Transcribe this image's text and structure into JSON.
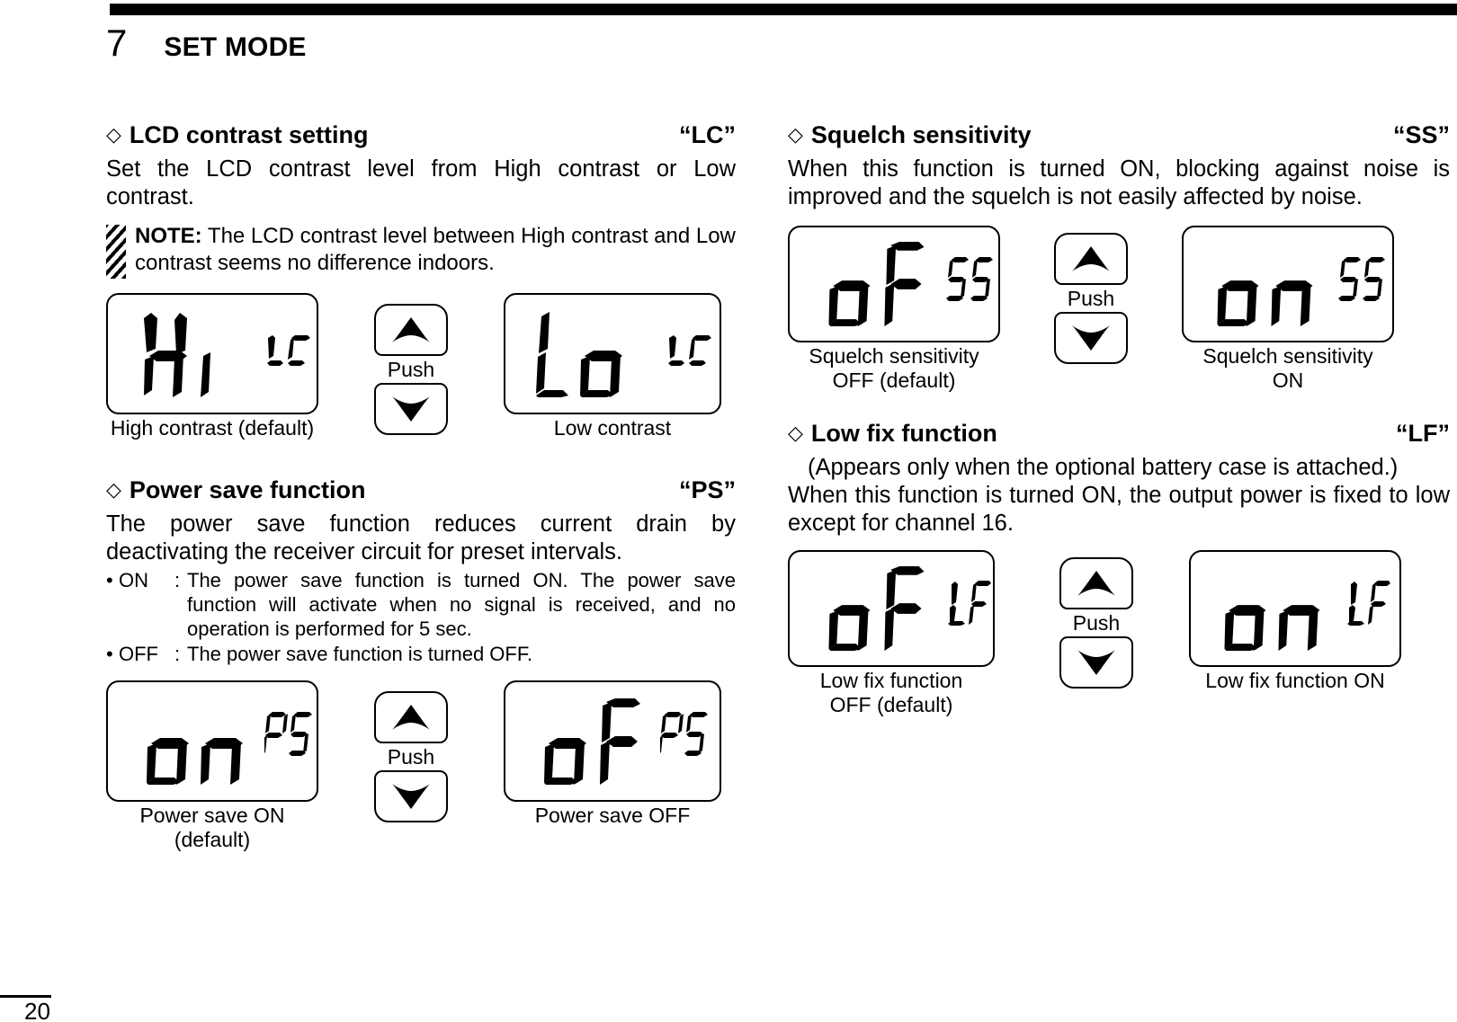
{
  "header": {
    "chapter_number": "7",
    "chapter_title": "SET MODE"
  },
  "footer": {
    "page_number": "20"
  },
  "left_column": {
    "sections": [
      {
        "diamond": "◇",
        "title": "LCD contrast setting",
        "code": "“LC”",
        "body": "Set the LCD contrast level from High contrast or Low contrast.",
        "note": {
          "label": "NOTE:",
          "text": " The LCD contrast level between High contrast and Low contrast seems no difference indoors."
        },
        "diagram": {
          "left_display": {
            "value": "Hi",
            "code": "LC"
          },
          "left_caption": "High contrast (default)",
          "push_label": "Push",
          "right_display": {
            "value": "Lo",
            "code": "LC"
          },
          "right_caption": "Low contrast"
        }
      },
      {
        "diamond": "◇",
        "title": "Power save function",
        "code": "“PS”",
        "body": "The power save function reduces current drain by deactivating the receiver circuit for preset intervals.",
        "bullets": [
          {
            "dot": "•",
            "key": "ON",
            "colon": ":",
            "text": "The power save function is turned ON. The power save function will activate when no signal is received, and no operation is performed for 5 sec."
          },
          {
            "dot": "•",
            "key": "OFF",
            "colon": ":",
            "text": "The power save function is turned OFF."
          }
        ],
        "diagram": {
          "left_display": {
            "value": "on",
            "code": "PS"
          },
          "left_caption": "Power save ON\n(default)",
          "push_label": "Push",
          "right_display": {
            "value": "oF",
            "code": "PS"
          },
          "right_caption": "Power save OFF"
        }
      }
    ]
  },
  "right_column": {
    "sections": [
      {
        "diamond": "◇",
        "title": "Squelch sensitivity",
        "code": "“SS”",
        "body": "When this function is turned ON, blocking against noise is improved and the squelch is not easily affected by noise.",
        "diagram": {
          "left_display": {
            "value": "oF",
            "code": "SS"
          },
          "left_caption": "Squelch sensitivity\nOFF (default)",
          "push_label": "Push",
          "right_display": {
            "value": "on",
            "code": "SS"
          },
          "right_caption": "Squelch sensitivity\nON"
        }
      },
      {
        "diamond": "◇",
        "title": "Low fix function",
        "code": "“LF”",
        "note_line": "(Appears only when the optional battery case is attached.)",
        "body": "When this function is turned ON, the output power is fixed to low except for channel 16.",
        "diagram": {
          "left_display": {
            "value": "oF",
            "code": "LF"
          },
          "left_caption": "Low fix function\nOFF (default)",
          "push_label": "Push",
          "right_display": {
            "value": "on",
            "code": "LF"
          },
          "right_caption": "Low fix function ON"
        }
      }
    ]
  },
  "icons": {
    "up_arrow": "triangle-up-icon",
    "down_arrow": "triangle-down-icon",
    "note_hatch": "hatch-stripe-icon",
    "diamond_bullet": "diamond-bullet-icon"
  },
  "colors": {
    "ink": "#000000",
    "paper": "#ffffff"
  }
}
